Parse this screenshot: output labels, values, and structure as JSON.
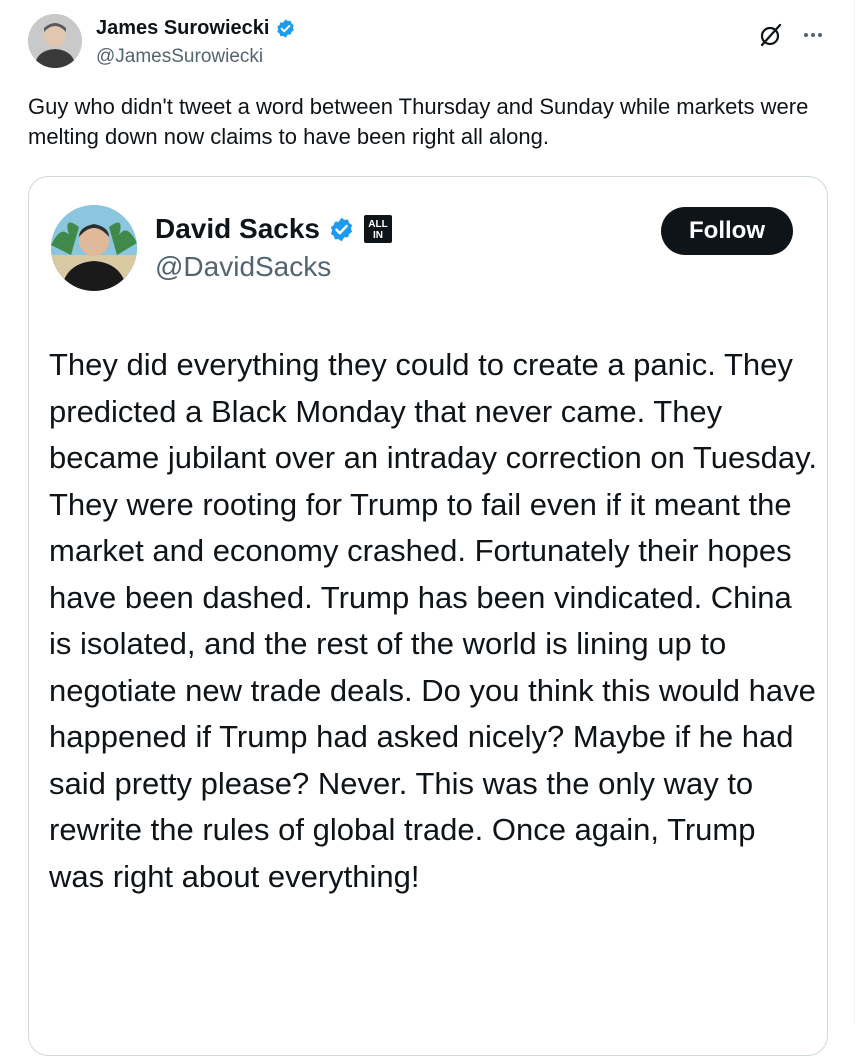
{
  "tweet": {
    "author_name": "James Surowiecki",
    "author_handle": "@JamesSurowiecki",
    "text": "Guy who didn't tweet a word between Thursday and Sunday while markets were melting down now claims to have been right all along.",
    "icons": {
      "grok": "grok-icon",
      "more": "more-icon",
      "verified": "verified-badge-icon"
    }
  },
  "quoted_tweet": {
    "author_name": "David Sacks",
    "author_handle": "@DavidSacks",
    "follow_label": "Follow",
    "affiliate_badge": "ALL IN",
    "text": "They did everything they could to create a panic. They predicted a Black Monday that never came. They became jubilant over an intraday correction on Tuesday. They were rooting for Trump to fail even if it meant the market and economy crashed. Fortunately their hopes have been dashed. Trump has been vindicated. China is isolated, and the rest of the world is lining up to negotiate new trade deals. Do you think this would have happened if Trump had asked nicely? Maybe if he had said pretty please? Never. This was the only way to rewrite the rules of global trade. Once again, Trump was right about everything!"
  },
  "colors": {
    "text_primary": "#0f1419",
    "text_secondary": "#536471",
    "verified_blue": "#1d9bf0",
    "border": "#cfd9de",
    "follow_bg": "#0f1419"
  }
}
